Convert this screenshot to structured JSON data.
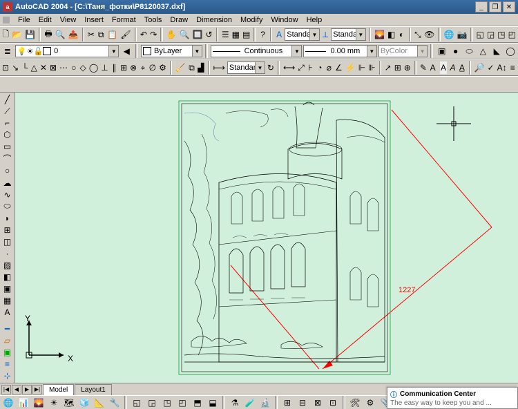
{
  "title": "AutoCAD 2004 - [C:\\Таня_фотки\\P8120037.dxf]",
  "menu": [
    "File",
    "Edit",
    "View",
    "Insert",
    "Format",
    "Tools",
    "Draw",
    "Dimension",
    "Modify",
    "Window",
    "Help"
  ],
  "layer_combo": "0",
  "textstyle1": "Standard",
  "textstyle2": "Standard",
  "dimstyle": "Standard",
  "bylayer": "ByLayer",
  "linetype": "Continuous",
  "lineweight": "0.00 mm",
  "color": "ByColor",
  "tabs": {
    "model": "Model",
    "layout1": "Layout1"
  },
  "dim_value": "1227",
  "ucs": {
    "x": "X",
    "y": "Y"
  },
  "comm": {
    "title": "Communication Center",
    "sub": "The easy way to keep you and ..."
  }
}
